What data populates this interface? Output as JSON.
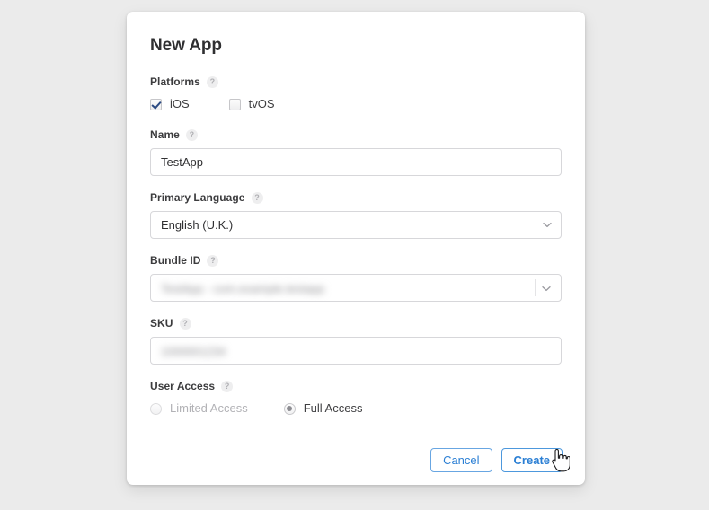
{
  "dialog": {
    "title": "New App"
  },
  "fields": {
    "platforms": {
      "label": "Platforms",
      "help": "?",
      "options": [
        {
          "label": "iOS",
          "checked": true
        },
        {
          "label": "tvOS",
          "checked": false
        }
      ]
    },
    "name": {
      "label": "Name",
      "help": "?",
      "value": "TestApp",
      "placeholder": ""
    },
    "primary_language": {
      "label": "Primary Language",
      "help": "?",
      "value": "English (U.K.)",
      "chevron": "chevron-down-icon"
    },
    "bundle_id": {
      "label": "Bundle ID",
      "help": "?",
      "value": "TestApp - com.example.testapp",
      "redacted": true,
      "chevron": "chevron-down-icon"
    },
    "sku": {
      "label": "SKU",
      "help": "?",
      "value": "1000001234",
      "redacted": true
    },
    "user_access": {
      "label": "User Access",
      "help": "?",
      "options": [
        {
          "label": "Limited Access",
          "selected": false,
          "disabled": true
        },
        {
          "label": "Full Access",
          "selected": true,
          "disabled": false
        }
      ]
    }
  },
  "footer": {
    "cancel_label": "Cancel",
    "create_label": "Create"
  },
  "colors": {
    "accent": "#2b7fd4",
    "button_border": "#68a6e2",
    "label_text": "#3c3c3e",
    "input_border": "#d7d7da",
    "page_background": "#ebebeb",
    "modal_background": "#ffffff",
    "checkmark": "#2b4a82",
    "radio_dot": "#8d8d92"
  }
}
